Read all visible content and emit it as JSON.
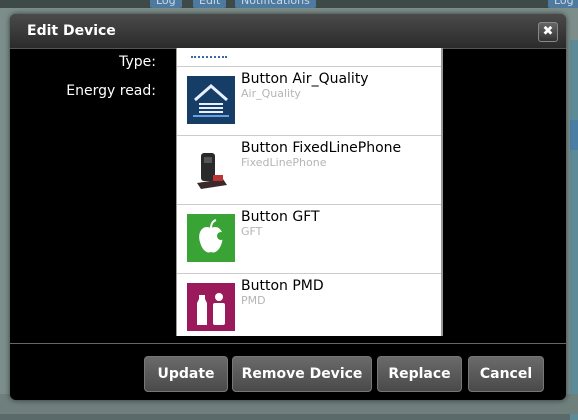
{
  "background": {
    "tabs": [
      "Log",
      "Edit",
      "Notifications",
      "Log"
    ]
  },
  "dialog": {
    "title": "Edit Device",
    "close_icon": "close-icon",
    "labels": {
      "type": "Type:",
      "energy_read": "Energy read:"
    },
    "list_items": [
      {
        "name": "Button Air_Quality",
        "sub": "Air_Quality",
        "icon": "air-quality-icon",
        "color": "#1a4f86"
      },
      {
        "name": "Button FixedLinePhone",
        "sub": "FixedLinePhone",
        "icon": "phone-icon",
        "color": "#ffffff"
      },
      {
        "name": "Button GFT",
        "sub": "GFT",
        "icon": "apple-icon",
        "color": "#3aa336"
      },
      {
        "name": "Button PMD",
        "sub": "PMD",
        "icon": "bottle-icon",
        "color": "#9b1a5c"
      }
    ],
    "buttons": {
      "update": "Update",
      "remove": "Remove Device",
      "replace": "Replace",
      "cancel": "Cancel"
    }
  }
}
